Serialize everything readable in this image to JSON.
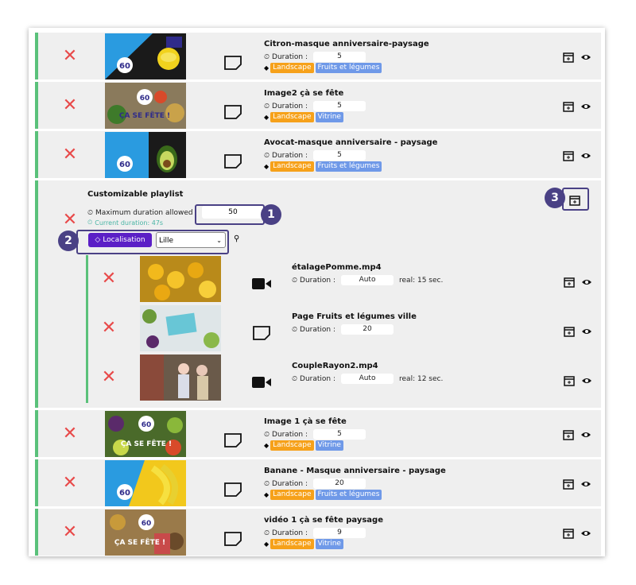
{
  "items_top": [
    {
      "title": "Citron-masque anniversaire-paysage",
      "duration_label": "Duration :",
      "duration": "5",
      "tags": [
        "Landscape",
        "Fruits et légumes"
      ]
    },
    {
      "title": "Image2 çà se fête",
      "duration_label": "Duration :",
      "duration": "5",
      "tags": [
        "Landscape",
        "Vitrine"
      ]
    },
    {
      "title": "Avocat-masque anniversaire - paysage",
      "duration_label": "Duration :",
      "duration": "5",
      "tags": [
        "Landscape",
        "Fruits et légumes"
      ]
    }
  ],
  "custom_playlist": {
    "title": "Customizable playlist",
    "max_label": "Maximum duration allowed",
    "max_value": "50",
    "current_label": "Current duration: 47s",
    "localisation_button": "Localisation",
    "select_value": "Lille",
    "children": [
      {
        "title": "étalagePomme.mp4",
        "duration_label": "Duration :",
        "duration": "Auto",
        "real": "real: 15 sec.",
        "type": "video"
      },
      {
        "title": "Page Fruits et légumes ville",
        "duration_label": "Duration :",
        "duration": "20",
        "real": "",
        "type": "page"
      },
      {
        "title": "CoupleRayon2.mp4",
        "duration_label": "Duration :",
        "duration": "Auto",
        "real": "real: 12 sec.",
        "type": "video"
      }
    ]
  },
  "items_bottom": [
    {
      "title": "Image 1 çà se fête",
      "duration_label": "Duration :",
      "duration": "5",
      "tags": [
        "Landscape",
        "Vitrine"
      ]
    },
    {
      "title": "Banane - Masque anniversaire - paysage",
      "duration_label": "Duration :",
      "duration": "20",
      "tags": [
        "Landscape",
        "Fruits et légumes"
      ]
    },
    {
      "title": "vidéo 1 çà se fête paysage",
      "duration_label": "Duration :",
      "duration": "9",
      "tags": [
        "Landscape",
        "Vitrine"
      ]
    }
  ],
  "badges": [
    "1",
    "2",
    "3"
  ],
  "thumb_text": {
    "sale": "ÇA SE FÊTE !",
    "logo": "60"
  },
  "colors": {
    "green": "#5ac17a",
    "red_x": "#e84a4a",
    "orange_tag": "#f6a11a",
    "blue_tag": "#6f99e8",
    "purple": "#4a4185",
    "loc_btn": "#5b1fc6"
  }
}
